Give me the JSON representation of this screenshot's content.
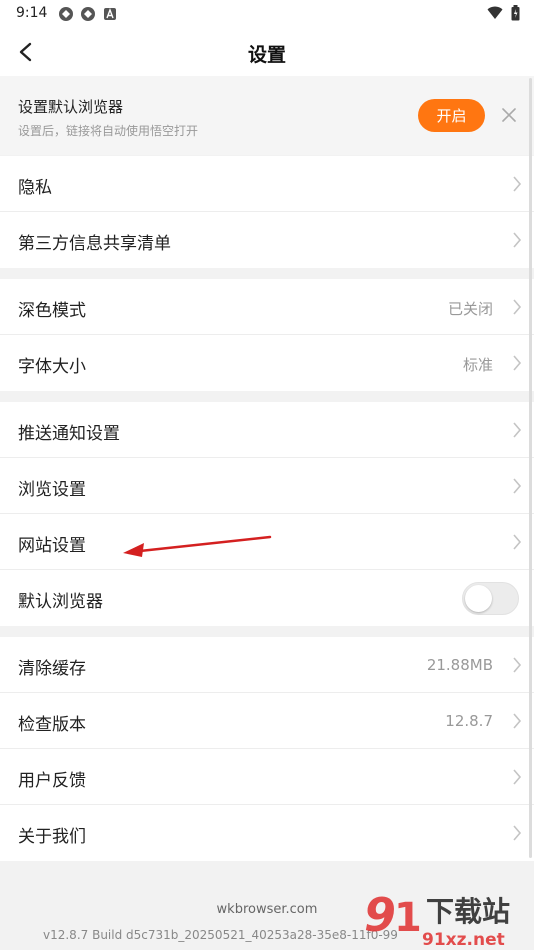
{
  "status_bar": {
    "time": "9:14"
  },
  "header": {
    "title": "设置"
  },
  "banner": {
    "title": "设置默认浏览器",
    "subtitle": "设置后，链接将自动使用悟空打开",
    "button_label": "开启"
  },
  "groups": [
    {
      "items": [
        {
          "label": "隐私"
        },
        {
          "label": "第三方信息共享清单"
        }
      ]
    },
    {
      "items": [
        {
          "label": "深色模式",
          "value": "已关闭"
        },
        {
          "label": "字体大小",
          "value": "标准"
        }
      ]
    },
    {
      "items": [
        {
          "label": "推送通知设置"
        },
        {
          "label": "浏览设置"
        },
        {
          "label": "网站设置"
        },
        {
          "label": "默认浏览器",
          "toggle": false
        }
      ]
    },
    {
      "items": [
        {
          "label": "清除缓存",
          "value": "21.88MB"
        },
        {
          "label": "检查版本",
          "value": "12.8.7"
        },
        {
          "label": "用户反馈"
        },
        {
          "label": "关于我们"
        }
      ]
    }
  ],
  "footer": {
    "domain": "wkbrowser.com",
    "build": "v12.8.7 Build d5c731b_20250521_40253a28-35e8-11f0-99"
  },
  "watermark": {
    "text": "下载站",
    "url_text": "91xz.net"
  },
  "colors": {
    "accent": "#ff7611",
    "annotation_arrow": "#d42020"
  }
}
